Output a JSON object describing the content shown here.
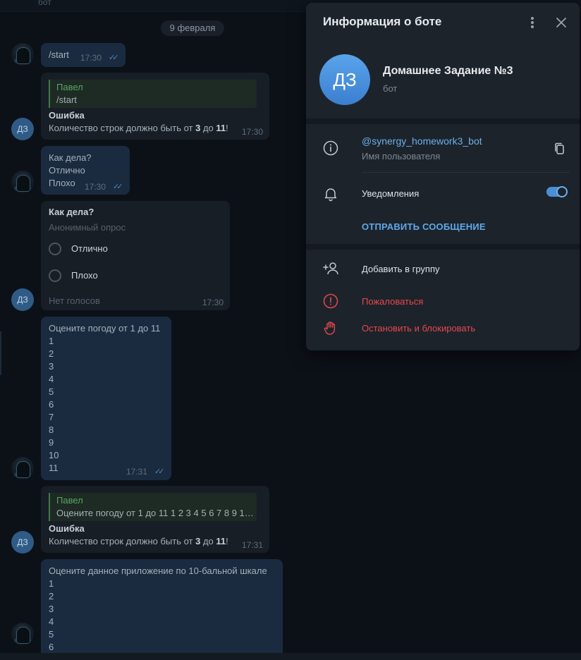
{
  "chat": {
    "top_title": "бот",
    "date": "9 февраля",
    "messages": [
      {
        "text": "/start",
        "time": "17:30"
      },
      {
        "reply_name": "Павел",
        "reply_text": "/start",
        "title": "Ошибка",
        "body_prefix": "Количество строк должно быть от ",
        "n1": "3",
        "mid": " до ",
        "n2": "11",
        "end": "!",
        "time": "17:30"
      },
      {
        "lines": [
          "Как дела?",
          "Отлично",
          "Плохо"
        ],
        "time": "17:30"
      },
      {
        "poll_question": "Как дела?",
        "poll_type": "Анонимный опрос",
        "options": [
          "Отлично",
          "Плохо"
        ],
        "votes": "Нет голосов",
        "time": "17:30"
      },
      {
        "lines": [
          "Оцените погоду от 1 до 11",
          "1",
          "2",
          "3",
          "4",
          "5",
          "6",
          "7",
          "8",
          "9",
          "10",
          "11"
        ],
        "time": "17:31"
      },
      {
        "reply_name": "Павел",
        "reply_text": "Оцените погоду от 1 до 11 1 2 3 4 5 6 7 8 9 10 ...",
        "title": "Ошибка",
        "body_prefix": "Количество строк должно быть от ",
        "n1": "3",
        "mid": " до ",
        "n2": "11",
        "end": "!",
        "time": "17:31"
      },
      {
        "lines": [
          "Оцените данное приложение по 10-бальной шкале",
          "1",
          "2",
          "3",
          "4",
          "5",
          "6"
        ]
      }
    ],
    "bot_avatar_initials": "ДЗ"
  },
  "panel": {
    "title": "Информация о боте",
    "bot_name": "Домашнее Задание №3",
    "bot_sub": "бот",
    "avatar_initials": "ДЗ",
    "username": "@synergy_homework3_bot",
    "username_label": "Имя пользователя",
    "notifications_label": "Уведомления",
    "notifications_on": true,
    "send_message": "ОТПРАВИТЬ СООБЩЕНИЕ",
    "add_to_group": "Добавить в группу",
    "report": "Пожаловаться",
    "block": "Остановить и блокировать"
  },
  "colors": {
    "accent": "#4a8fd4",
    "danger": "#e5484d",
    "reply_green": "#5aa562"
  },
  "icons": [
    "info-icon",
    "copy-icon",
    "bell-icon",
    "add-user-icon",
    "report-icon",
    "stop-hand-icon",
    "more-vertical-icon",
    "close-icon",
    "double-check-icon"
  ]
}
